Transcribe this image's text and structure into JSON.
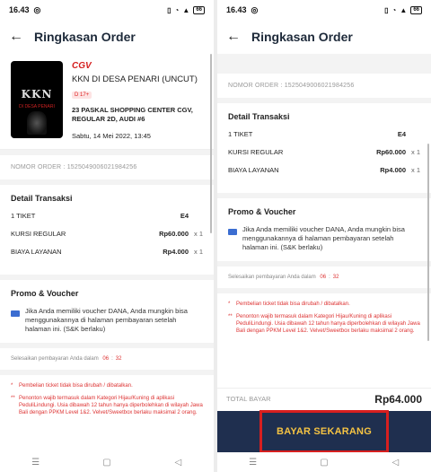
{
  "status": {
    "time": "16.43",
    "battery": "66"
  },
  "appbar": {
    "title": "Ringkasan Order"
  },
  "movie": {
    "cinema_brand": "CGV",
    "title": "KKN DI DESA PENARI (UNCUT)",
    "rating": "D 17+",
    "venue": "23 PASKAL SHOPPING CENTER CGV, REGULAR 2D, AUDI #6",
    "date": "Sabtu, 14 Mei 2022, 13:45",
    "poster_title": "KKN",
    "poster_subtitle": "DI DESA PENARI"
  },
  "order": {
    "number_label": "NOMOR ORDER : 1525049006021984256"
  },
  "transaction": {
    "title": "Detail Transaksi",
    "rows": [
      {
        "label": "1 TIKET",
        "value": "E4",
        "qty": ""
      },
      {
        "label": "KURSI REGULAR",
        "value": "Rp60.000",
        "qty": "x 1"
      },
      {
        "label": "BIAYA LAYANAN",
        "value": "Rp4.000",
        "qty": "x 1"
      }
    ]
  },
  "promo": {
    "title": "Promo & Voucher",
    "text": "Jika Anda memiliki voucher DANA, Anda mungkin bisa menggunakannya di halaman pembayaran setelah halaman ini. (S&K berlaku)"
  },
  "timer": {
    "label": "Selesaikan pembayaran Anda dalam",
    "minutes": "06",
    "sep": ":",
    "seconds": "32"
  },
  "notes": [
    {
      "star": "*",
      "text": "Pembelian ticket tidak bisa dirubah / dibatalkan."
    },
    {
      "star": "**",
      "text": "Penonton wajib termasuk dalam Kategori Hijau/Kuning di aplikasi PeduliLindungi. Usia dibawah 12 tahun hanya diperbolehkan di wilayah Jawa Bali dengan PPKM Level 1&2. Velvet/Sweetbox berlaku maksimal 2 orang."
    }
  ],
  "total": {
    "label": "TOTAL BAYAR",
    "value": "Rp64.000"
  },
  "pay": {
    "label": "BAYAR SEKARANG"
  },
  "icons": {
    "back": "arrow-left-icon",
    "promo": "voucher-icon"
  },
  "colors": {
    "accent_red": "#d71f1f",
    "pay_bg": "#1f2f4f",
    "pay_text": "#f5c343",
    "note_red": "#d33333"
  }
}
